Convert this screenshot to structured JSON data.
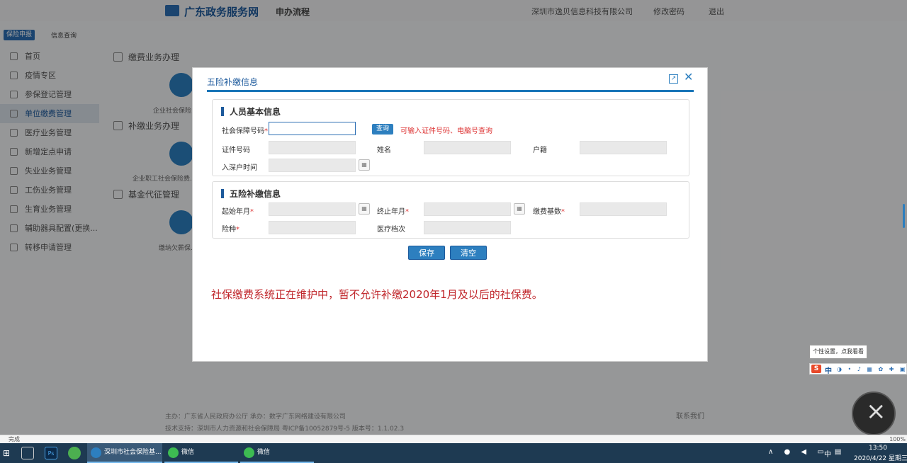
{
  "header": {
    "site_title": "广东政务服务网",
    "subtitle": "申办流程",
    "company": "深圳市逸贝信息科技有限公司",
    "change_password": "修改密码",
    "exit": "退出"
  },
  "top_tabs": [
    "保险申报",
    "信息查询"
  ],
  "sidebar": {
    "items": [
      "首页",
      "疫情专区",
      "参保登记管理",
      "单位缴费管理",
      "医疗业务管理",
      "新增定点申请",
      "失业业务管理",
      "工伤业务管理",
      "生育业务管理",
      "辅助器具配置(更换...",
      "转移申请管理"
    ],
    "active_index": 3
  },
  "sections": [
    {
      "title": "缴费业务办理",
      "item": "企业社会保险..."
    },
    {
      "title": "补缴业务办理",
      "item": "企业职工社会保险费..."
    },
    {
      "title": "基金代征管理",
      "item": "缴纳欠薪保..."
    }
  ],
  "footer": {
    "line1": "主办：广东省人民政府办公厅   承办：数字广东网络建设有限公司",
    "line2": "技术支持：深圳市人力资源和社会保障局   粤ICP备10052879号-5   版本号：1.1.02.3",
    "contact": "联系我们"
  },
  "modal": {
    "title": "五险补缴信息",
    "panel1": {
      "title": "人员基本信息",
      "ssn_label": "社会保障号码",
      "query_button": "查询",
      "hint": "可输入证件号码、电脑号查询",
      "id_label": "证件号码",
      "name_label": "姓名",
      "hukou_label": "户籍",
      "entry_label": "入深户时间"
    },
    "panel2": {
      "title": "五险补缴信息",
      "start_label": "起始年月",
      "end_label": "终止年月",
      "base_label": "缴费基数",
      "type_label": "险种",
      "level_label": "医疗档次"
    },
    "required_mark": "*",
    "save_button": "保存",
    "clear_button": "清空",
    "notice": "社保缴费系统正在维护中，暂不允许补缴2020年1月及以后的社保费。"
  },
  "ime": {
    "tooltip": "个性设置，点我看看",
    "logo": "S",
    "lang": "中"
  },
  "statusbar": {
    "text": "完成",
    "zoom": "100%"
  },
  "taskbar": {
    "tasks": [
      "深圳市社会保险基...",
      "微信",
      "微信"
    ],
    "ps_label": "Ps",
    "tray_ime": "中",
    "time": "13:50",
    "date": "2020/4/22 星期三"
  },
  "colors": {
    "accent": "#2d7fbf",
    "brand": "#1d5a9c",
    "warning": "#c0262b"
  }
}
